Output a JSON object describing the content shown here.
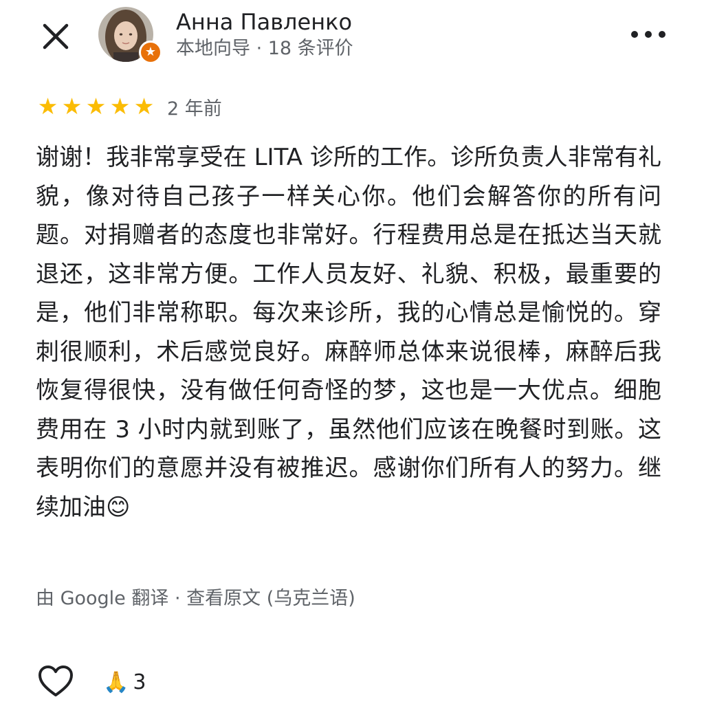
{
  "header": {
    "author_name": "Анна Павленко",
    "author_meta": "本地向导 · 18 条评价",
    "guide_badge_icon": "star-icon"
  },
  "review": {
    "rating": 5,
    "rating_max": 5,
    "date": "2 年前",
    "text": "谢谢！我非常享受在 LITA 诊所的工作。诊所负责人非常有礼貌，像对待自己孩子一样关心你。他们会解答你的所有问题。对捐赠者的态度也非常好。行程费用总是在抵达当天就退还，这非常方便。工作人员友好、礼貌、积极，最重要的是，他们非常称职。每次来诊所，我的心情总是愉悦的。穿刺很顺利，术后感觉良好。麻醉师总体来说很棒，麻醉后我恢复得很快，没有做任何奇怪的梦，这也是一大优点。细胞费用在 3 小时内就到账了，虽然他们应该在晚餐时到账。这表明你们的意愿并没有被推迟。感谢你们所有人的努力。继续加油😊"
  },
  "translation": {
    "prefix": "由 Google 翻译 · ",
    "link": "查看原文 (乌克兰语)"
  },
  "footer": {
    "reaction_emoji": "🙏",
    "reaction_count": "3"
  },
  "colors": {
    "star": "#fbbc04",
    "badge": "#e8710a",
    "secondary_text": "#5f6368",
    "primary_text": "#202124"
  }
}
